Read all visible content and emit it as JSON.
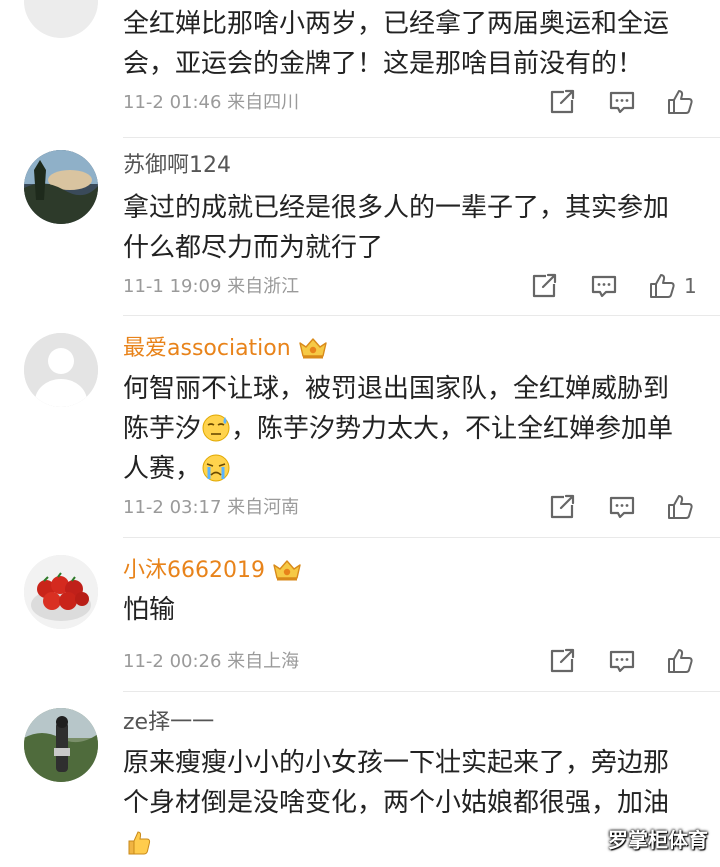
{
  "comments": [
    {
      "username": "",
      "lines": [
        "全红婵比那啥小两岁，已经拿了两届奥运和全运",
        "会，亚运会的金牌了！这是那啥目前没有的！"
      ],
      "meta": "11-2 01:46 来自四川",
      "likes": ""
    },
    {
      "username": "苏御啊124",
      "lines": [
        "拿过的成就已经是很多人的一辈子了，其实参加",
        "什么都尽力而为就行了"
      ],
      "meta": "11-1 19:09 来自浙江",
      "likes": "1"
    },
    {
      "username": "最爱association",
      "lines_a": [
        "何智丽不让球，被罚退出国家队，全红婵威胁到"
      ],
      "line2_pre": "陈芋汐",
      "line2_post": "，陈芋汐势力太大，不让全红婵参加单",
      "line3_pre": "人赛，",
      "meta": "11-2 03:17 来自河南",
      "likes": ""
    },
    {
      "username": "小沐6662019",
      "lines": [
        "怕输"
      ],
      "meta": "11-2 00:26 来自上海",
      "likes": ""
    },
    {
      "username": "ze择一一",
      "lines": [
        "原来瘦瘦小小的小女孩一下壮实起来了，旁边那",
        "个身材倒是没啥变化，两个小姑娘都很强，加油"
      ],
      "meta": "",
      "likes": ""
    }
  ],
  "icons": {
    "share": "share-icon",
    "comment": "comment-icon",
    "like": "like-icon",
    "vip": "vip-crown-icon",
    "emoji_sweat": "sweat-emoji-icon",
    "emoji_cry": "crying-emoji-icon",
    "emoji_thumb": "thumbs-up-emoji-icon"
  },
  "colors": {
    "username_vip": "#e8831a",
    "username_normal": "#555555",
    "meta": "#9a9a9a",
    "text": "#222222"
  },
  "watermark": "罗掌柜体育"
}
